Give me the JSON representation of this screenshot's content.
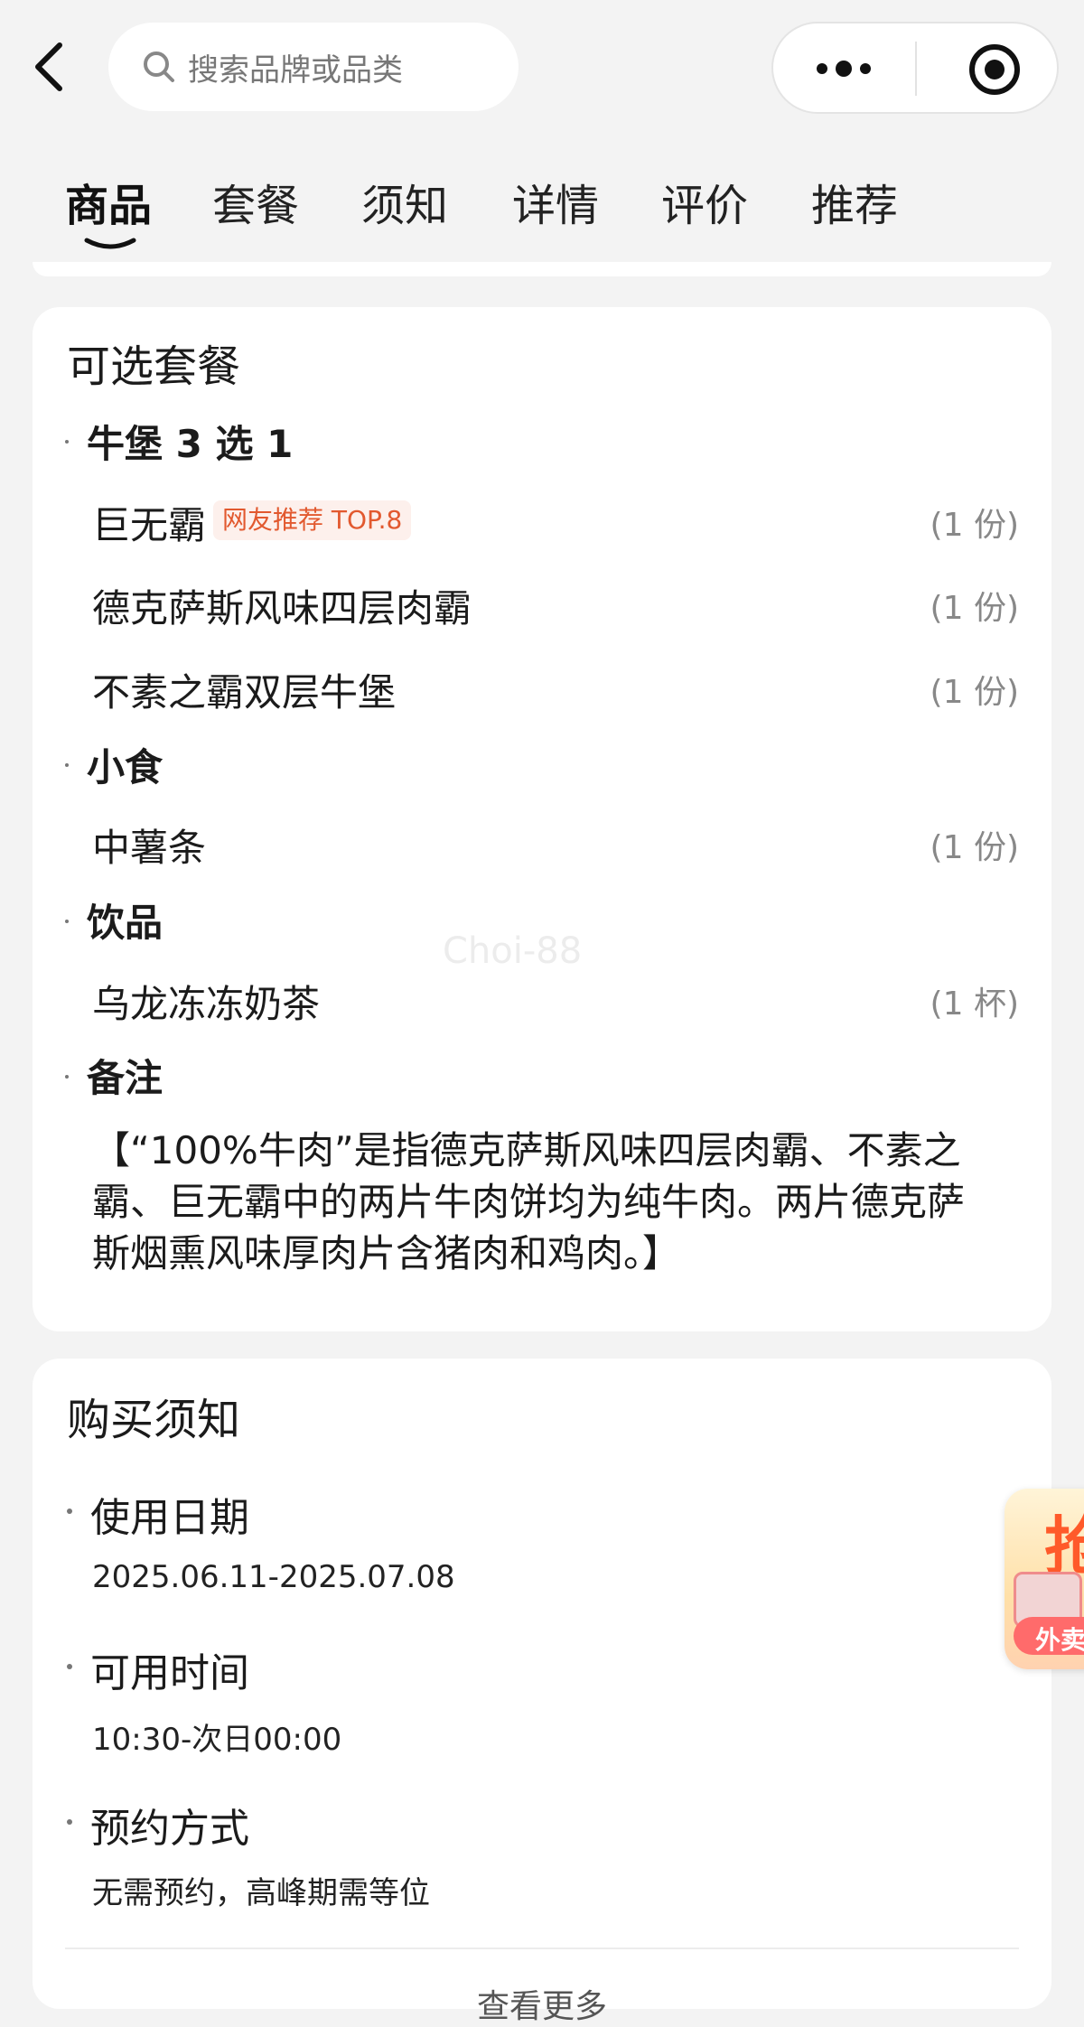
{
  "search": {
    "placeholder": "搜索品牌或品类"
  },
  "tabs": [
    {
      "label": "商品",
      "active": true
    },
    {
      "label": "套餐"
    },
    {
      "label": "须知"
    },
    {
      "label": "详情"
    },
    {
      "label": "评价"
    },
    {
      "label": "推荐"
    }
  ],
  "package_card": {
    "title": "可选套餐",
    "groups": [
      {
        "title": "牛堡 3 选 1",
        "items": [
          {
            "name": "巨无霸",
            "tag": "网友推荐 TOP.8",
            "qty": "(1 份)"
          },
          {
            "name": "德克萨斯风味四层肉霸",
            "qty": "(1 份)"
          },
          {
            "name": "不素之霸双层牛堡",
            "qty": "(1 份)"
          }
        ]
      },
      {
        "title": "小食",
        "items": [
          {
            "name": "中薯条",
            "qty": "(1 份)"
          }
        ]
      },
      {
        "title": "饮品",
        "items": [
          {
            "name": "乌龙冻冻奶茶",
            "qty": "(1 杯)"
          }
        ]
      }
    ],
    "note_title": "备注",
    "note_lines": [
      "【“100%牛肉”是指德克萨斯风味四层肉霸、不素之",
      "霸、巨无霸中的两片牛肉饼均为纯牛肉。两片德克萨",
      "斯烟熏风味厚肉片含猪肉和鸡肉。】"
    ],
    "watermark": "Choi-88"
  },
  "notice_card": {
    "title": "购买须知",
    "sections": [
      {
        "label": "使用日期",
        "value": "2025.06.11-2025.07.08"
      },
      {
        "label": "可用时间",
        "value": "10:30-次日00:00"
      },
      {
        "label": "预约方式",
        "value": "无需预约，高峰期需等位"
      }
    ],
    "view_more": "查看更多"
  },
  "float_badge": {
    "big_char": "抢",
    "pill": "外卖"
  },
  "icons": {
    "back": "back-arrow-icon",
    "search": "search-icon",
    "more": "more-dots-icon",
    "target": "target-icon"
  },
  "colors": {
    "accent": "#e2592f",
    "background": "#f3f3f3",
    "card": "#ffffff"
  }
}
